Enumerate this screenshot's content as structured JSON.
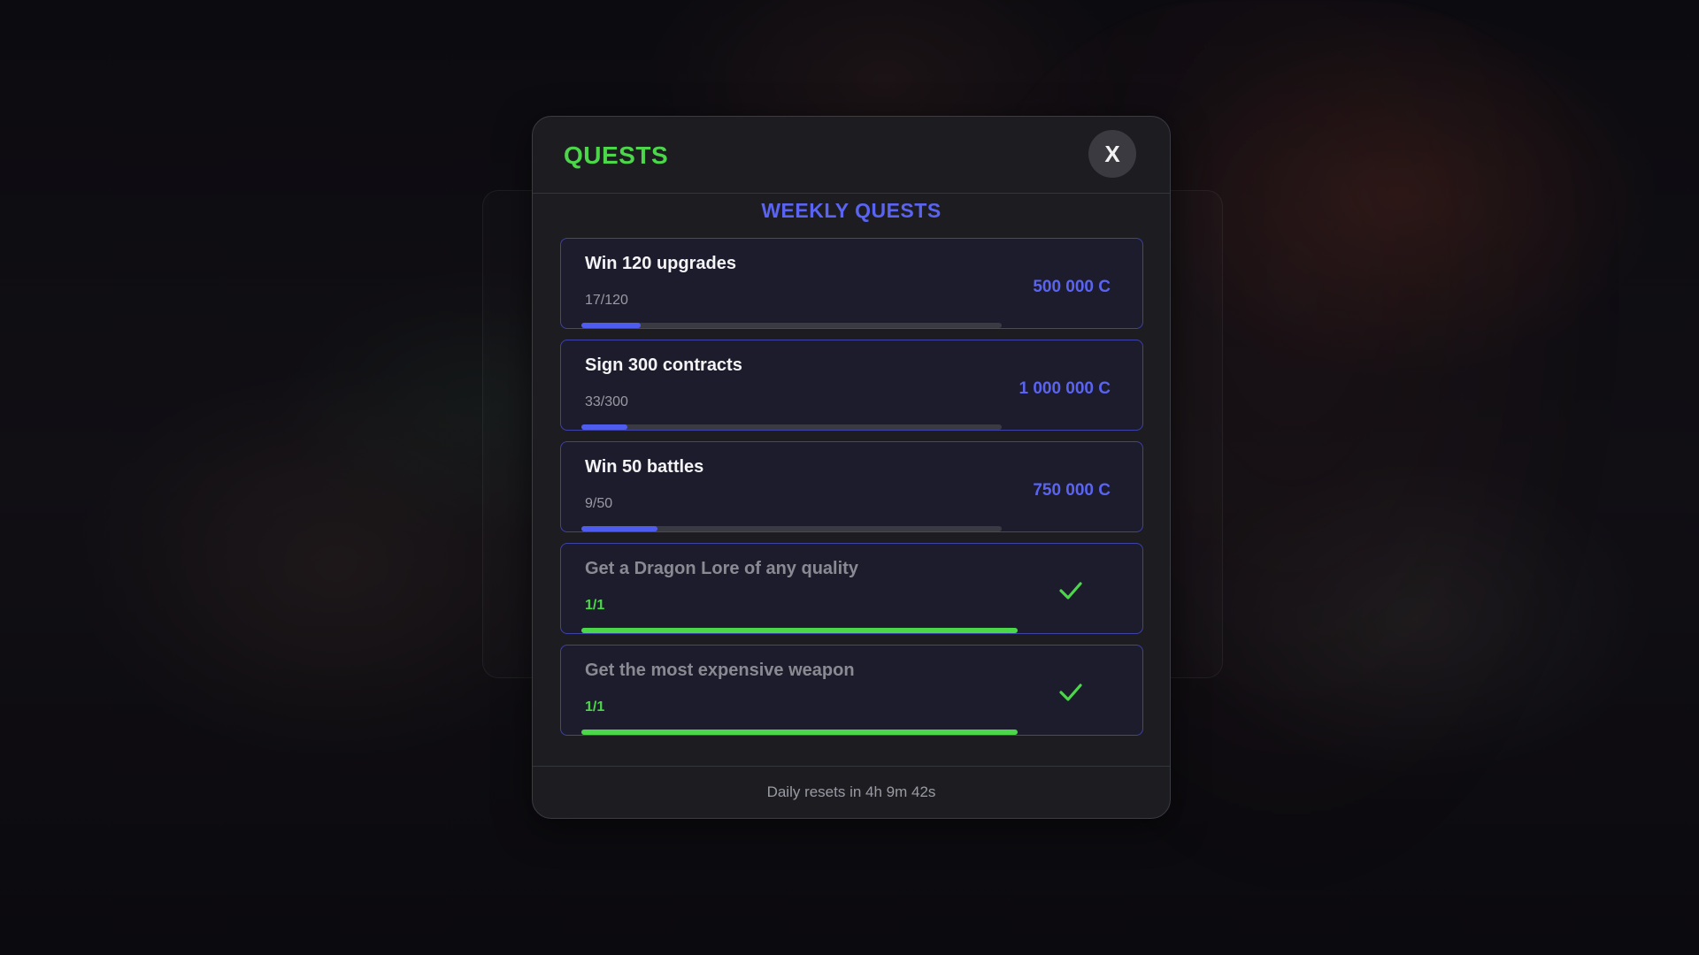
{
  "modal": {
    "title": "QUESTS",
    "close_label": "X",
    "section_title": "WEEKLY QUESTS",
    "footer_text": "Daily resets in 4h 9m 42s"
  },
  "quests": [
    {
      "title": "Win 120 upgrades",
      "progress_text": "17/120",
      "reward": "500 000 C",
      "completed": false,
      "progress": 0.1417
    },
    {
      "title": "Sign 300 contracts",
      "progress_text": "33/300",
      "reward": "1 000 000 C",
      "completed": false,
      "progress": 0.11
    },
    {
      "title": "Win 50 battles",
      "progress_text": "9/50",
      "reward": "750 000 C",
      "completed": false,
      "progress": 0.18
    },
    {
      "title": "Get a Dragon Lore of any quality",
      "progress_text": "1/1",
      "reward": "",
      "completed": true,
      "progress": 1.0
    },
    {
      "title": "Get the most expensive weapon",
      "progress_text": "1/1",
      "reward": "",
      "completed": true,
      "progress": 1.0
    }
  ],
  "icons": {
    "close": "close-icon",
    "check": "check-icon"
  },
  "colors": {
    "title_green": "#4cd64a",
    "accent_blue": "#5a64f0",
    "progress_blue": "#4f5cf0",
    "progress_green": "#4cd64a",
    "card_border": "#3c42a8"
  }
}
